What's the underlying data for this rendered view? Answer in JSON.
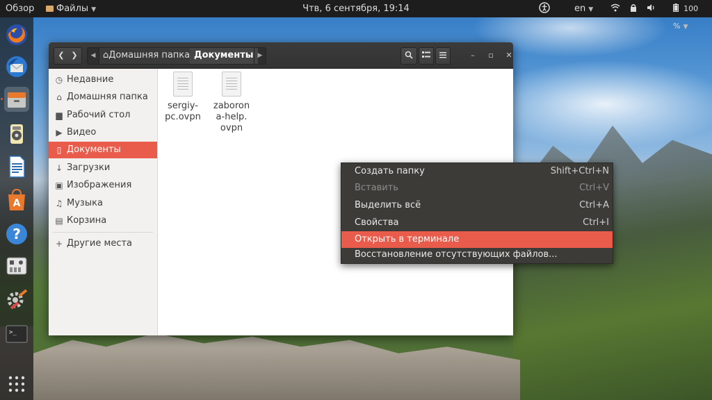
{
  "topbar": {
    "activities": "Обзор",
    "app_menu": "Файлы",
    "clock": "Чтв, 6 сентября, 19:14",
    "language": "en",
    "battery": "100 %",
    "icons": [
      "accessibility-icon",
      "wifi-icon",
      "lock-icon",
      "volume-icon",
      "battery-icon"
    ]
  },
  "dock": {
    "apps": [
      "firefox",
      "thunderbird",
      "files",
      "rhythmbox",
      "libreoffice-writer",
      "ubuntu-software",
      "help",
      "system-monitor",
      "settings",
      "terminal",
      "show-applications"
    ]
  },
  "window": {
    "path": {
      "home": "Домашняя папка",
      "current": "Документы"
    },
    "sidebar": {
      "items": [
        {
          "label": "Недавние",
          "icon": "clock-icon"
        },
        {
          "label": "Домашняя папка",
          "icon": "home-icon"
        },
        {
          "label": "Рабочий стол",
          "icon": "folder-icon"
        },
        {
          "label": "Видео",
          "icon": "video-icon"
        },
        {
          "label": "Документы",
          "icon": "documents-icon",
          "active": true
        },
        {
          "label": "Загрузки",
          "icon": "download-icon"
        },
        {
          "label": "Изображения",
          "icon": "pictures-icon"
        },
        {
          "label": "Музыка",
          "icon": "music-icon"
        },
        {
          "label": "Корзина",
          "icon": "trash-icon"
        },
        {
          "label": "Другие места",
          "icon": "plus-icon"
        }
      ]
    },
    "files": [
      {
        "name": "sergiy-\npc.ovpn"
      },
      {
        "name": "zaboron\na-help.\novpn"
      }
    ]
  },
  "context_menu": {
    "items": [
      {
        "label": "Создать папку",
        "shortcut": "Shift+Ctrl+N",
        "state": "normal"
      },
      {
        "label": "Вставить",
        "shortcut": "Ctrl+V",
        "state": "disabled"
      },
      {
        "label": "Выделить всё",
        "shortcut": "Ctrl+A",
        "state": "normal"
      },
      {
        "label": "Свойства",
        "shortcut": "Ctrl+I",
        "state": "normal"
      },
      {
        "label": "Открыть в терминале",
        "shortcut": "",
        "state": "selected"
      },
      {
        "label": "Восстановление отсутствующих файлов...",
        "shortcut": "",
        "state": "normal"
      }
    ]
  },
  "colors": {
    "accent": "#e95b4b",
    "topbar": "#1d1d1d",
    "headerbar": "#3b3b3b",
    "menu_bg": "#3c3b37"
  }
}
